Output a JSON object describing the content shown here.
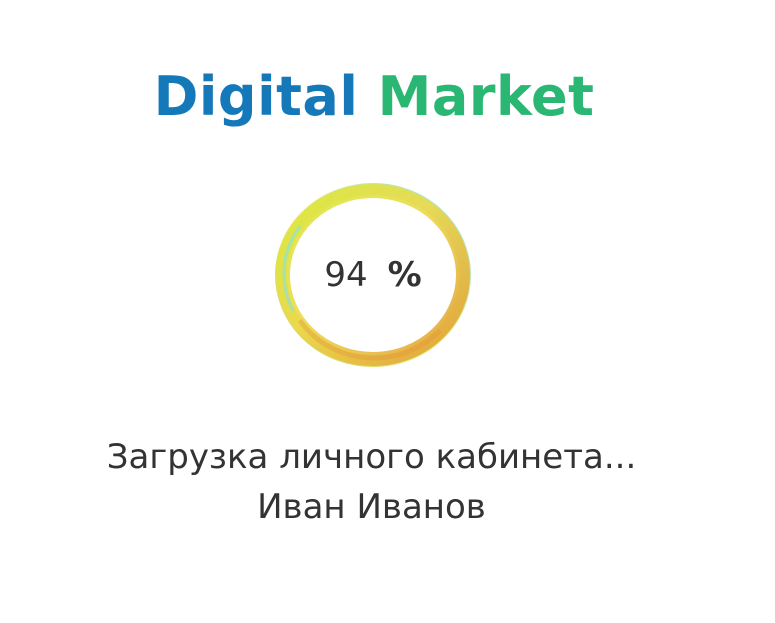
{
  "brand": {
    "word1": "Digital",
    "word2": "Market",
    "word1_color": "#1478b9",
    "word2_color": "#2ab673"
  },
  "loader": {
    "progress_value": "94",
    "progress_sign": "%",
    "ring_colors": [
      "#dfe73a",
      "#f2d84a",
      "#e7a93c",
      "#8fe3e6"
    ]
  },
  "status": {
    "message": "Загрузка личного кабинета...",
    "user_name": "Иван Иванов"
  }
}
